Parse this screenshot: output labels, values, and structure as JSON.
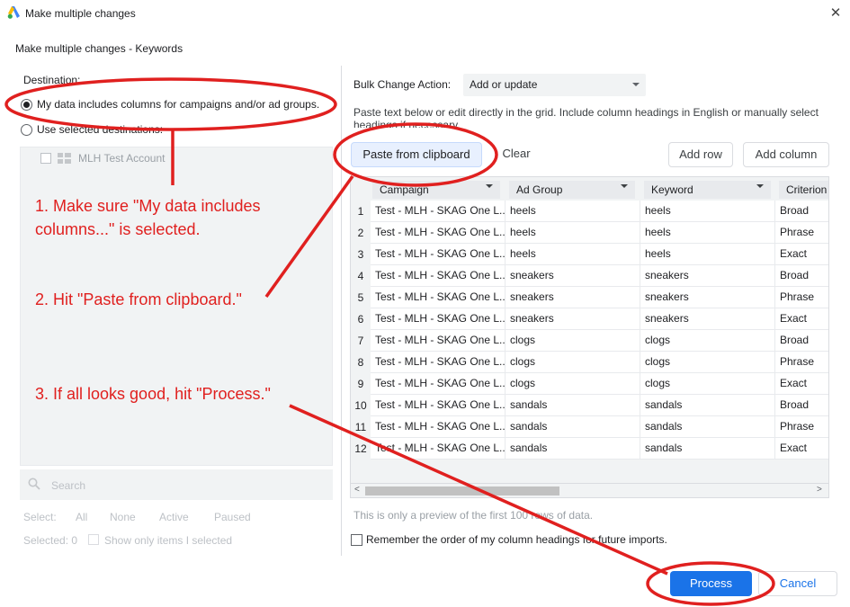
{
  "window": {
    "title": "Make multiple changes",
    "subtitle": "Make multiple changes - Keywords",
    "close_glyph": "✕"
  },
  "destination": {
    "label": "Destination:",
    "option_my_data": "My data includes columns for campaigns and/or ad groups.",
    "option_use_selected": "Use selected destinations:",
    "account_name": "MLH Test Account",
    "search_placeholder": "Search",
    "select_label": "Select:",
    "select_options": [
      "All",
      "None",
      "Active",
      "Paused"
    ],
    "selected_count": "Selected: 0",
    "show_only_label": "Show only items I selected"
  },
  "bulk": {
    "label": "Bulk Change Action:",
    "value": "Add or update",
    "instructions": "Paste text below or edit directly in the grid. Include column headings in English or manually select headings if necessary."
  },
  "toolbar": {
    "paste_label": "Paste from clipboard",
    "clear_label": "Clear",
    "add_row_label": "Add row",
    "add_column_label": "Add column"
  },
  "grid": {
    "columns": [
      "Campaign",
      "Ad Group",
      "Keyword",
      "Criterion"
    ],
    "rows": [
      {
        "num": "1",
        "campaign": "Test - MLH - SKAG One L...",
        "ad_group": "heels",
        "keyword": "heels",
        "criterion": "Broad"
      },
      {
        "num": "2",
        "campaign": "Test - MLH - SKAG One L...",
        "ad_group": "heels",
        "keyword": "heels",
        "criterion": "Phrase"
      },
      {
        "num": "3",
        "campaign": "Test - MLH - SKAG One L...",
        "ad_group": "heels",
        "keyword": "heels",
        "criterion": "Exact"
      },
      {
        "num": "4",
        "campaign": "Test - MLH - SKAG One L...",
        "ad_group": "sneakers",
        "keyword": "sneakers",
        "criterion": "Broad"
      },
      {
        "num": "5",
        "campaign": "Test - MLH - SKAG One L...",
        "ad_group": "sneakers",
        "keyword": "sneakers",
        "criterion": "Phrase"
      },
      {
        "num": "6",
        "campaign": "Test - MLH - SKAG One L...",
        "ad_group": "sneakers",
        "keyword": "sneakers",
        "criterion": "Exact"
      },
      {
        "num": "7",
        "campaign": "Test - MLH - SKAG One L...",
        "ad_group": "clogs",
        "keyword": "clogs",
        "criterion": "Broad"
      },
      {
        "num": "8",
        "campaign": "Test - MLH - SKAG One L...",
        "ad_group": "clogs",
        "keyword": "clogs",
        "criterion": "Phrase"
      },
      {
        "num": "9",
        "campaign": "Test - MLH - SKAG One L...",
        "ad_group": "clogs",
        "keyword": "clogs",
        "criterion": "Exact"
      },
      {
        "num": "10",
        "campaign": "Test - MLH - SKAG One L...",
        "ad_group": "sandals",
        "keyword": "sandals",
        "criterion": "Broad"
      },
      {
        "num": "11",
        "campaign": "Test - MLH - SKAG One L...",
        "ad_group": "sandals",
        "keyword": "sandals",
        "criterion": "Phrase"
      },
      {
        "num": "12",
        "campaign": "Test - MLH - SKAG One L...",
        "ad_group": "sandals",
        "keyword": "sandals",
        "criterion": "Exact"
      }
    ],
    "scroll_left_glyph": "<",
    "scroll_right_glyph": ">"
  },
  "footer": {
    "preview_note": "This is only a preview of the first 100 rows of data.",
    "remember_label": "Remember the order of my column headings for future imports.",
    "process_label": "Process",
    "cancel_label": "Cancel"
  },
  "annotations": {
    "step1": "1. Make sure \"My data includes columns...\" is selected.",
    "step2": "2. Hit \"Paste from clipboard.\"",
    "step3": "3. If all looks good, hit \"Process.\"",
    "color": "#e0201f"
  },
  "colors": {
    "primary": "#1a73e8",
    "panel_bg": "#f1f3f4",
    "paste_bg": "#e8f0fe"
  }
}
